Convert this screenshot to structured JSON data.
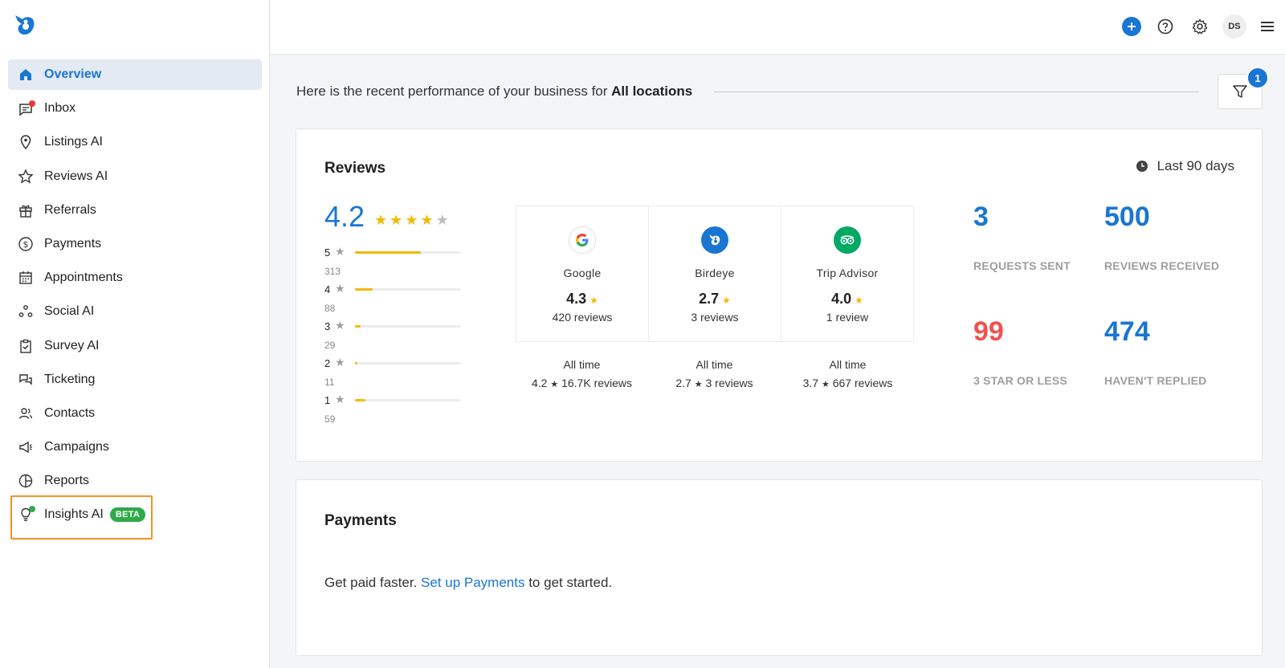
{
  "sidebar": {
    "items": [
      {
        "label": "Overview",
        "icon": "home-icon"
      },
      {
        "label": "Inbox",
        "icon": "inbox-icon"
      },
      {
        "label": "Listings AI",
        "icon": "location-pin-icon"
      },
      {
        "label": "Reviews AI",
        "icon": "star-icon"
      },
      {
        "label": "Referrals",
        "icon": "gift-icon"
      },
      {
        "label": "Payments",
        "icon": "dollar-circle-icon"
      },
      {
        "label": "Appointments",
        "icon": "calendar-icon"
      },
      {
        "label": "Social AI",
        "icon": "social-nodes-icon"
      },
      {
        "label": "Survey AI",
        "icon": "clipboard-check-icon"
      },
      {
        "label": "Ticketing",
        "icon": "chat-bubbles-icon"
      },
      {
        "label": "Contacts",
        "icon": "users-icon"
      },
      {
        "label": "Campaigns",
        "icon": "megaphone-icon"
      },
      {
        "label": "Reports",
        "icon": "pie-chart-icon"
      },
      {
        "label": "Insights AI",
        "icon": "lightbulb-icon",
        "badge": "BETA"
      }
    ],
    "active": "Overview"
  },
  "header": {
    "avatar_initials": "DS"
  },
  "intro": {
    "text": "Here is the recent performance of your business for ",
    "scope": "All locations",
    "filter_count": "1"
  },
  "reviews": {
    "title": "Reviews",
    "period": "Last 90 days",
    "overall_rating": "4.2",
    "overall_stars": 4,
    "distribution": [
      {
        "star": "5",
        "count": "313",
        "fraction": 0.62
      },
      {
        "star": "4",
        "count": "88",
        "fraction": 0.17
      },
      {
        "star": "3",
        "count": "29",
        "fraction": 0.05
      },
      {
        "star": "2",
        "count": "11",
        "fraction": 0.02
      },
      {
        "star": "1",
        "count": "59",
        "fraction": 0.1
      }
    ],
    "sources": [
      {
        "name": "Google",
        "rating": "4.3",
        "count": "420 reviews",
        "alltime_label": "All time",
        "alltime_rating": "4.2",
        "alltime_count": "16.7K reviews"
      },
      {
        "name": "Birdeye",
        "rating": "2.7",
        "count": "3 reviews",
        "alltime_label": "All time",
        "alltime_rating": "2.7",
        "alltime_count": "3 reviews"
      },
      {
        "name": "Trip Advisor",
        "rating": "4.0",
        "count": "1 review",
        "alltime_label": "All time",
        "alltime_rating": "3.7",
        "alltime_count": "667 reviews"
      }
    ],
    "stats": [
      {
        "value": "3",
        "label": "REQUESTS SENT",
        "color": "#1976d2"
      },
      {
        "value": "500",
        "label": "REVIEWS RECEIVED",
        "color": "#1976d2"
      },
      {
        "value": "99",
        "label": "3 STAR OR LESS",
        "color": "#ef5350"
      },
      {
        "value": "474",
        "label": "HAVEN'T REPLIED",
        "color": "#1976d2"
      }
    ]
  },
  "payments": {
    "title": "Payments",
    "text_before": "Get paid faster. ",
    "link": "Set up Payments",
    "text_after": " to get started."
  },
  "colors": {
    "accent": "#1976d2",
    "star": "#f5b800",
    "highlight": "#f5921f",
    "beta": "#2eaa4a",
    "negative": "#ef5350"
  }
}
